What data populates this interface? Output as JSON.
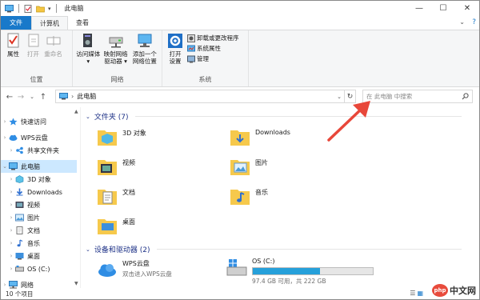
{
  "window": {
    "title": "此电脑",
    "controls": {
      "minimize": "—",
      "maximize": "☐",
      "close": "✕"
    }
  },
  "tabs": {
    "file": "文件",
    "computer": "计算机",
    "view": "查看"
  },
  "ribbon": {
    "location": {
      "label": "位置",
      "properties": "属性",
      "open": "打开",
      "rename": "重命名"
    },
    "network": {
      "label": "网络",
      "access_media": [
        "访问媒体",
        "▾"
      ],
      "map_drive": [
        "映射网络",
        "驱动器 ▾"
      ],
      "add_location": [
        "添加一个",
        "网络位置"
      ]
    },
    "system": {
      "label": "系统",
      "open_settings": [
        "打开",
        "设置"
      ],
      "uninstall": "卸载或更改程序",
      "system_properties": "系统属性",
      "manage": "管理"
    }
  },
  "address": {
    "path": "此电脑",
    "search_placeholder": "在 此电脑 中搜索"
  },
  "nav": {
    "quick_access": "快速访问",
    "wps_cloud": "WPS云盘",
    "shared_folder": "共享文件夹",
    "this_pc": "此电脑",
    "objects3d": "3D 对象",
    "downloads": "Downloads",
    "videos": "视频",
    "pictures": "图片",
    "documents": "文档",
    "music": "音乐",
    "desktop": "桌面",
    "os_c": "OS (C:)",
    "network": "网络"
  },
  "content": {
    "folders_header": "文件夹 (7)",
    "folders": [
      {
        "name": "3D 对象",
        "icon": "3d-objects-folder-icon"
      },
      {
        "name": "Downloads",
        "icon": "downloads-folder-icon"
      },
      {
        "name": "视频",
        "icon": "videos-folder-icon"
      },
      {
        "name": "图片",
        "icon": "pictures-folder-icon"
      },
      {
        "name": "文档",
        "icon": "documents-folder-icon"
      },
      {
        "name": "音乐",
        "icon": "music-folder-icon"
      },
      {
        "name": "桌面",
        "icon": "desktop-folder-icon"
      }
    ],
    "devices_header": "设备和驱动器 (2)",
    "wps": {
      "name": "WPS云盘",
      "sub": "双击进入WPS云盘"
    },
    "os": {
      "name": "OS (C:)",
      "free_text": "97.4 GB 可用，共 222 GB",
      "used_fraction": 0.56
    }
  },
  "status": {
    "count": "10 个项目"
  },
  "watermark": {
    "php": "php",
    "cn": "中文网"
  },
  "colors": {
    "accent": "#1979ca",
    "selected": "#cce8ff",
    "drive_bar": "#26a0da",
    "section_header": "#1e3287",
    "annotation_arrow": "#e8473a"
  }
}
